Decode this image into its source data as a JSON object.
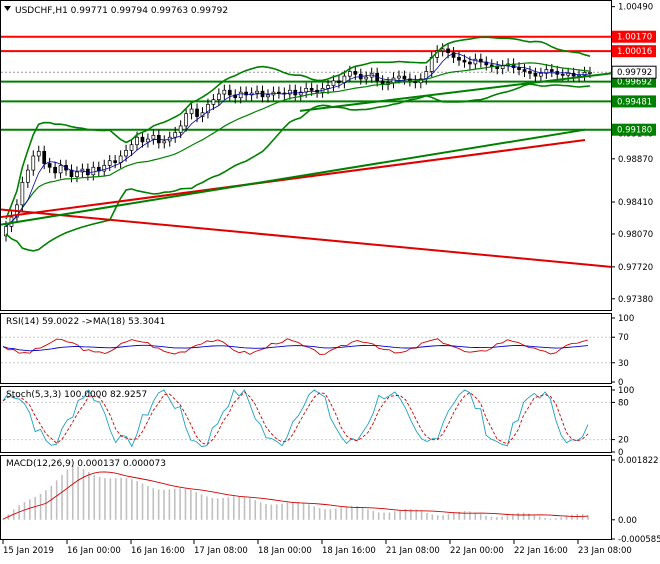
{
  "symbol_header": {
    "menu_arrow": "triangle-down-icon",
    "text": "USDCHF,H1  0.99771 0.99794 0.99763 0.99792"
  },
  "colors": {
    "grid_red": "#ff0000",
    "grid_green": "#008000",
    "bollinger": "#008000",
    "ma_red": "#e00000",
    "ma_green": "#008000",
    "rsi_line": "#d00000",
    "rsi_ma": "#0000cc",
    "stoch_main": "#20a0c0",
    "stoch_signal": "#d00000",
    "macd_hist": "#c0c0c0",
    "macd_signal": "#d00000",
    "price_tag_bg": "#ff0000",
    "price_tag_green": "#008000",
    "current_tag_bg": "#ffffff"
  },
  "x_axis_labels": [
    "15 Jan 2019",
    "16 Jan 00:00",
    "16 Jan 16:00",
    "17 Jan 08:00",
    "18 Jan 00:00",
    "18 Jan 16:00",
    "21 Jan 08:00",
    "22 Jan 00:00",
    "22 Jan 16:00",
    "23 Jan 08:00"
  ],
  "chart_data": [
    {
      "type": "line",
      "title": "USDCHF,H1",
      "y_axis_ticks": [
        "1.00490",
        "1.00220",
        "0.99950",
        "0.99680",
        "0.99410",
        "0.99140",
        "0.98870",
        "0.98600",
        "0.98330",
        "0.98060",
        "0.97790",
        "0.97520"
      ],
      "y_axis_ticks_visible": [
        "1.00490",
        "0.99140",
        "0.98870",
        "0.98410",
        "0.98070",
        "0.97720",
        "0.97380"
      ],
      "ylim": [
        0.9725,
        1.0055
      ],
      "horizontal_levels": [
        {
          "label": "1.00170",
          "value": 1.0017,
          "color": "red"
        },
        {
          "label": "1.00016",
          "value": 1.00016,
          "color": "red"
        },
        {
          "label": "0.99692",
          "value": 0.99692,
          "color": "green"
        },
        {
          "label": "0.99481",
          "value": 0.99481,
          "color": "green"
        },
        {
          "label": "0.99180",
          "value": 0.9918,
          "color": "green"
        }
      ],
      "current_price": {
        "label": "0.99792",
        "value": 0.99792
      },
      "candles_close": [
        0.9815,
        0.9825,
        0.9838,
        0.9862,
        0.9875,
        0.989,
        0.9895,
        0.9882,
        0.9878,
        0.9872,
        0.988,
        0.9875,
        0.9868,
        0.9873,
        0.9876,
        0.987,
        0.9878,
        0.9874,
        0.988,
        0.9885,
        0.9883,
        0.989,
        0.9896,
        0.9902,
        0.991,
        0.9905,
        0.9908,
        0.9912,
        0.9904,
        0.9906,
        0.991,
        0.9915,
        0.9922,
        0.9935,
        0.994,
        0.9932,
        0.9936,
        0.9945,
        0.995,
        0.9956,
        0.996,
        0.9955,
        0.9952,
        0.9958,
        0.9955,
        0.9957,
        0.9959,
        0.9953,
        0.9955,
        0.9958,
        0.9957,
        0.9956,
        0.996,
        0.9955,
        0.9958,
        0.9962,
        0.996,
        0.9958,
        0.9962,
        0.9965,
        0.997,
        0.9968,
        0.9975,
        0.998,
        0.9977,
        0.9972,
        0.9974,
        0.9978,
        0.997,
        0.9966,
        0.9968,
        0.9973,
        0.9975,
        0.9972,
        0.997,
        0.9968,
        0.9972,
        0.998,
        0.9995,
        1.0002,
        1.0004,
        1.0,
        0.9995,
        0.9992,
        0.999,
        0.9988,
        0.9993,
        0.999,
        0.9987,
        0.9985,
        0.9983,
        0.9986,
        0.9988,
        0.9984,
        0.9982,
        0.998,
        0.9978,
        0.9975,
        0.9978,
        0.9982,
        0.998,
        0.9977,
        0.9976,
        0.9978,
        0.9975,
        0.9976,
        0.9979,
        0.9979
      ]
    },
    {
      "type": "line",
      "title": "RSI(14) 59.0022 ->MA(18) 53.3041",
      "y_axis_ticks": [
        "100",
        "70",
        "30",
        "0"
      ],
      "ylim": [
        0,
        100
      ]
    },
    {
      "type": "line",
      "title": "Stoch(5,3,3) 100.0000 82.9257",
      "y_axis_ticks": [
        "100",
        "80",
        "20",
        "0"
      ],
      "ylim": [
        0,
        100
      ]
    },
    {
      "type": "bar",
      "title": "MACD(12,26,9) 0.000137 0.000073",
      "y_axis_ticks": [
        "0.001822",
        "0.00",
        "-0.000585"
      ],
      "ylim": [
        -0.000585,
        0.001822
      ]
    }
  ]
}
